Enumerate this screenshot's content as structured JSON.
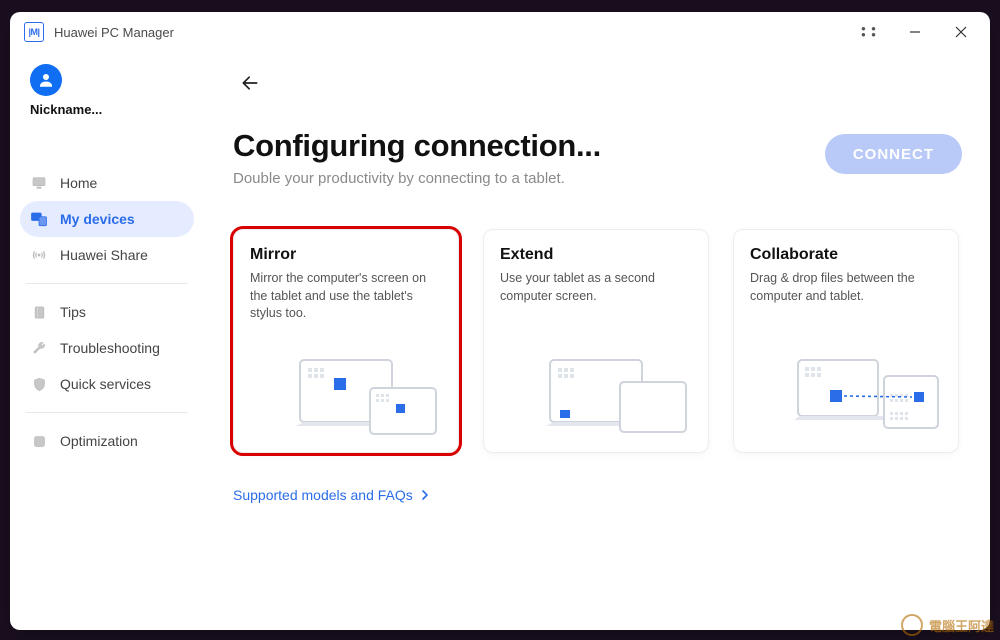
{
  "app": {
    "title": "Huawei PC Manager",
    "logo_text": "|M|"
  },
  "profile": {
    "nickname": "Nickname..."
  },
  "sidebar": {
    "items": [
      {
        "label": "Home"
      },
      {
        "label": "My devices"
      },
      {
        "label": "Huawei Share"
      },
      {
        "label": "Tips"
      },
      {
        "label": "Troubleshooting"
      },
      {
        "label": "Quick services"
      },
      {
        "label": "Optimization"
      }
    ]
  },
  "header": {
    "title": "Configuring connection...",
    "subtitle": "Double your productivity by connecting to a tablet.",
    "connect_label": "CONNECT"
  },
  "cards": [
    {
      "title": "Mirror",
      "desc": "Mirror the computer's screen on the tablet and use the tablet's stylus too."
    },
    {
      "title": "Extend",
      "desc": "Use your tablet as a second computer screen."
    },
    {
      "title": "Collaborate",
      "desc": "Drag & drop files between the computer and tablet."
    }
  ],
  "link": {
    "label": "Supported models and FAQs"
  },
  "watermark": {
    "text": "電腦王阿達"
  }
}
